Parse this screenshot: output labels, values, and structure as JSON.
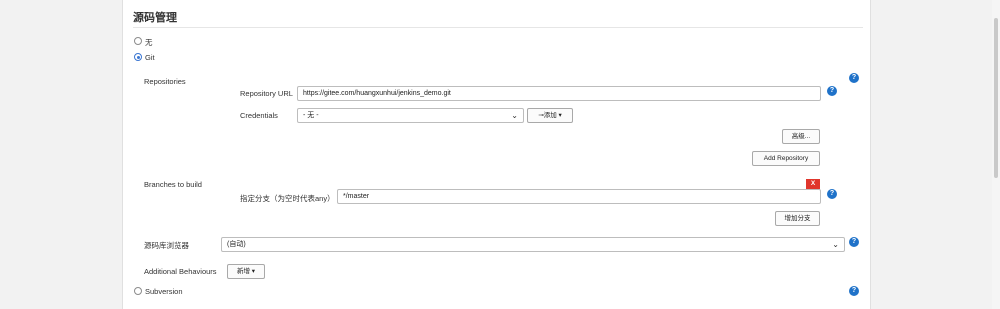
{
  "section": {
    "title": "源码管理"
  },
  "scm_options": {
    "none": "无",
    "git": "Git",
    "subversion": "Subversion"
  },
  "repositories": {
    "label": "Repositories",
    "url_label": "Repository URL",
    "url_value": "https://gitee.com/huangxunhui/jenkins_demo.git",
    "credentials_label": "Credentials",
    "credentials_value": "- 无 -",
    "add_button": "添加",
    "advanced_button": "高级...",
    "add_repository_button": "Add Repository"
  },
  "branches": {
    "label": "Branches to build",
    "delete_button": "X",
    "specifier_label": "指定分支（为空时代表any）",
    "specifier_value": "*/master",
    "add_branch_button": "增加分支"
  },
  "browser": {
    "label": "源码库浏览器",
    "value": "(自动)"
  },
  "behaviours": {
    "label": "Additional Behaviours",
    "add_button": "新增"
  },
  "icons": {
    "help": "help-icon",
    "chevron": "chevron-down-icon",
    "key": "key-icon"
  },
  "colors": {
    "help": "#1f72c9",
    "delete": "#e0362c",
    "radio": "#3a76d2"
  }
}
